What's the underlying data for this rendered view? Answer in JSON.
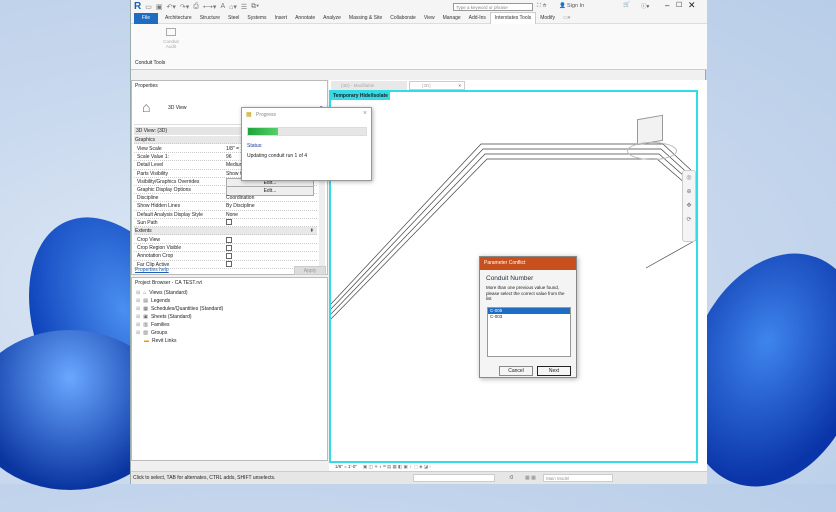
{
  "app": {
    "logo": "R"
  },
  "title_bar": {
    "search_placeholder": "Type a keyword or phrase",
    "sign_in": "Sign In"
  },
  "ribbon": {
    "tabs": [
      "File",
      "Architecture",
      "Structure",
      "Steel",
      "Systems",
      "Insert",
      "Annotate",
      "Analyze",
      "Massing & Site",
      "Collaborate",
      "View",
      "Manage",
      "Add-Ins",
      "Interstates Tools",
      "Modify"
    ],
    "active_tab": "Interstates Tools",
    "button_label": "Conduit Audit",
    "panel_label": "Conduit Tools"
  },
  "properties": {
    "title": "Properties",
    "type_name": "3D View",
    "instance": "3D View: {3D}",
    "sections": {
      "graphics": "Graphics",
      "extents": "Extents"
    },
    "rows": [
      {
        "k": "View Scale",
        "v": "1/8\" = 1'-0\""
      },
      {
        "k": "Scale Value    1:",
        "v": "96"
      },
      {
        "k": "Detail Level",
        "v": "Medium"
      },
      {
        "k": "Parts Visibility",
        "v": "Show Original"
      },
      {
        "k": "Visibility/Graphics Overrides",
        "v": "Edit..."
      },
      {
        "k": "Graphic Display Options",
        "v": "Edit..."
      },
      {
        "k": "Discipline",
        "v": "Coordination"
      },
      {
        "k": "Show Hidden Lines",
        "v": "By Discipline"
      },
      {
        "k": "Default Analysis Display Style",
        "v": "None"
      },
      {
        "k": "Sun Path",
        "v": ""
      }
    ],
    "extent_rows": [
      "Crop View",
      "Crop Region Visible",
      "Annotation Crop",
      "Far Clip Active"
    ],
    "help": "Properties help",
    "apply": "Apply"
  },
  "project_browser": {
    "title": "Project Browser - CA TEST.rvt",
    "items": [
      "Views (Standard)",
      "Legends",
      "Schedules/Quantities (Standard)",
      "Sheets (Standard)",
      "Families",
      "Groups",
      "Revit Links"
    ]
  },
  "view": {
    "tabs": [
      "{3D} - Modifiable",
      "{3D}"
    ],
    "temp_banner": "Temporary Hide/Isolate",
    "scale": "1/8\" = 1'-0\""
  },
  "progress": {
    "title": "Progress",
    "percent": 25,
    "status_label": "Status:",
    "status_text": "Updating conduit run 1 of 4"
  },
  "conflict": {
    "title": "Parameter Conflict",
    "heading": "Conduit Number",
    "message": "More than one previous value found, please select the correct value from the list",
    "options": [
      "C-005",
      "C-003"
    ],
    "selected": "C-005",
    "cancel": "Cancel",
    "next": "Next"
  },
  "statusbar": {
    "text": "Click to select, TAB for alternates, CTRL adds, SHIFT unselects.",
    "zero": ":0",
    "model": "Main Model"
  },
  "colors": {
    "accent": "#1e6dc2",
    "highlight": "#33dbe6",
    "dialog_header": "#c8501e"
  }
}
